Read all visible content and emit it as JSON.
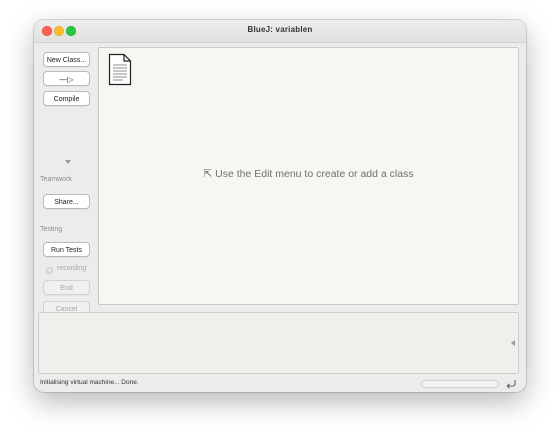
{
  "window": {
    "title": "BlueJ:  variablen"
  },
  "sidebar": {
    "new_class_label": "New Class...",
    "inheritance_arrow_label": "—▷",
    "compile_label": "Compile",
    "teamwork_label": "Teamwork",
    "share_label": "Share...",
    "testing_label": "Testing",
    "run_tests_label": "Run Tests",
    "recording_label": "recording",
    "end_label": "End",
    "cancel_label": "Cancel"
  },
  "main": {
    "hint": "⇱ Use the Edit menu to create or add a class",
    "readme_icon": "readme-file-icon"
  },
  "status": {
    "text": "Initialising virtual machine... Done."
  },
  "colors": {
    "close": "#ff5f57",
    "minimize": "#febc2e",
    "maximize": "#28c840",
    "canvas": "#f7f6f2"
  }
}
